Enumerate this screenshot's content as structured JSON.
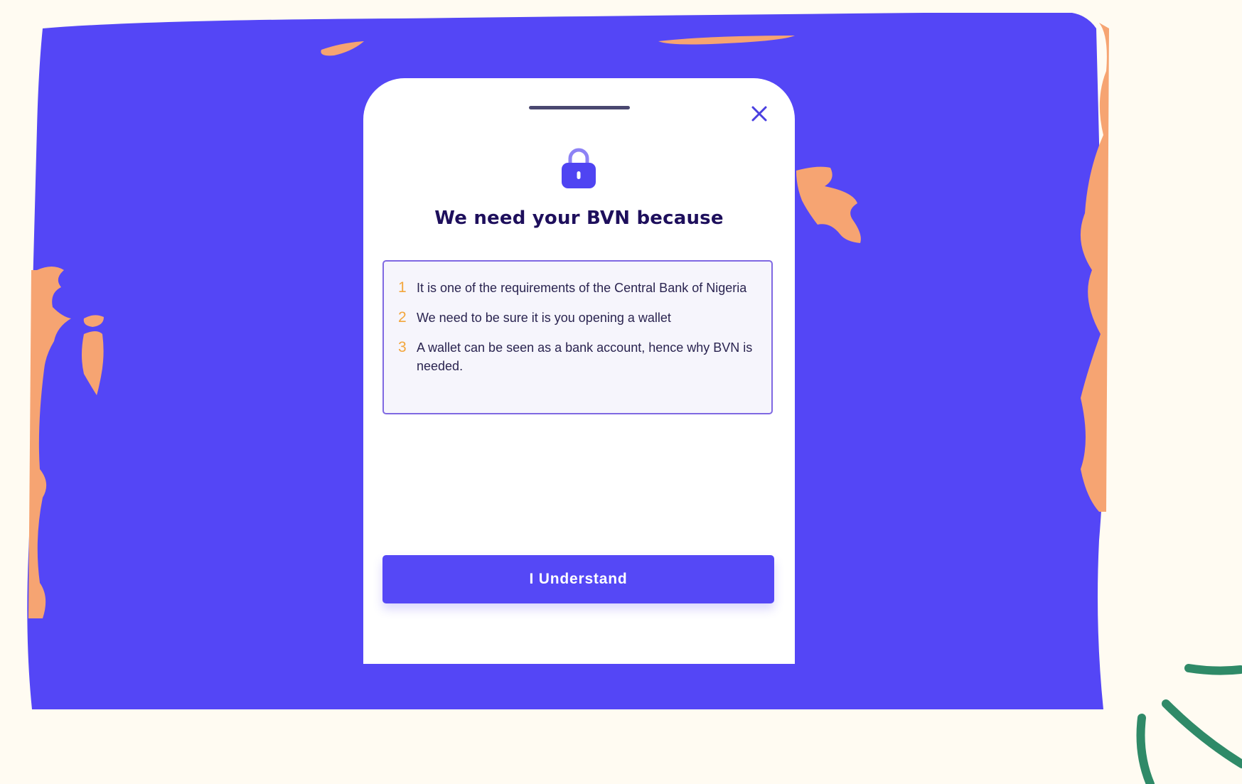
{
  "colors": {
    "page_background": "#FFFBF2",
    "blob": "#5446F6",
    "splash": "#F6A472",
    "title": "#1E0F5C",
    "number": "#F3A63C",
    "button": "#5548F6",
    "button_text": "#FFFFFF",
    "green_accent": "#2F8A68"
  },
  "modal": {
    "lock_icon": "lock-icon",
    "close_icon": "close-icon",
    "title": "We need your BVN because",
    "reasons": [
      {
        "number": "1",
        "text": "It is one of the requirements of the Central Bank of Nigeria"
      },
      {
        "number": "2",
        "text": "We need to be sure it is you opening a wallet"
      },
      {
        "number": "3",
        "text": "A wallet can be seen as a bank account, hence why BVN is needed."
      }
    ],
    "button_label": "I Understand"
  }
}
